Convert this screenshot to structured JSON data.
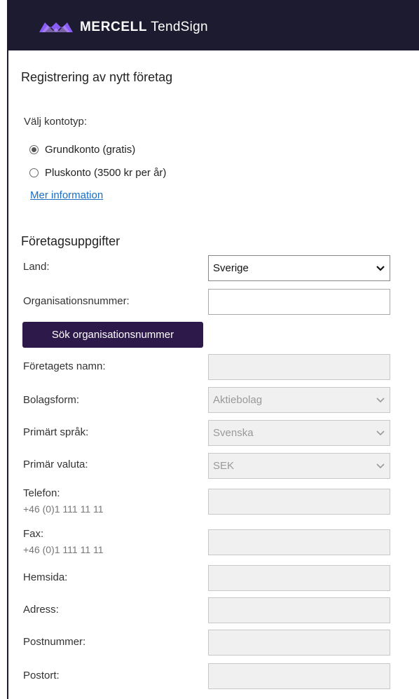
{
  "header": {
    "brand_bold": "MERCELL",
    "brand_light": "TendSign",
    "logo_icon": "mercell-logo-icon"
  },
  "page_title": "Registrering av nytt företag",
  "account": {
    "label": "Välj kontotyp:",
    "options": [
      {
        "label": "Grundkonto (gratis)",
        "selected": true
      },
      {
        "label": "Pluskonto (3500 kr per år)",
        "selected": false
      }
    ],
    "more_info_link": "Mer information"
  },
  "company": {
    "section_title": "Företagsuppgifter",
    "land": {
      "label": "Land:",
      "value": "Sverige"
    },
    "org_number": {
      "label": "Organisationsnummer:",
      "value": ""
    },
    "search_button": "Sök organisationsnummer",
    "name": {
      "label": "Företagets namn:",
      "value": ""
    },
    "company_form": {
      "label": "Bolagsform:",
      "value": "Aktiebolag"
    },
    "primary_language": {
      "label": "Primärt språk:",
      "value": "Svenska"
    },
    "primary_currency": {
      "label": "Primär valuta:",
      "value": "SEK"
    },
    "phone": {
      "label": "Telefon:",
      "hint": "+46 (0)1 111 11 11",
      "value": ""
    },
    "fax": {
      "label": "Fax:",
      "hint": "+46 (0)1 111 11 11",
      "value": ""
    },
    "website": {
      "label": "Hemsida:",
      "value": ""
    },
    "address": {
      "label": "Adress:",
      "value": ""
    },
    "postal_code": {
      "label": "Postnummer:",
      "value": ""
    },
    "city": {
      "label": "Postort:",
      "value": ""
    }
  },
  "colors": {
    "header_bg": "#1d1b2f",
    "button_bg": "#2e1a4a",
    "link": "#1b6ec2",
    "logo_accent": "#8a5cf6"
  }
}
